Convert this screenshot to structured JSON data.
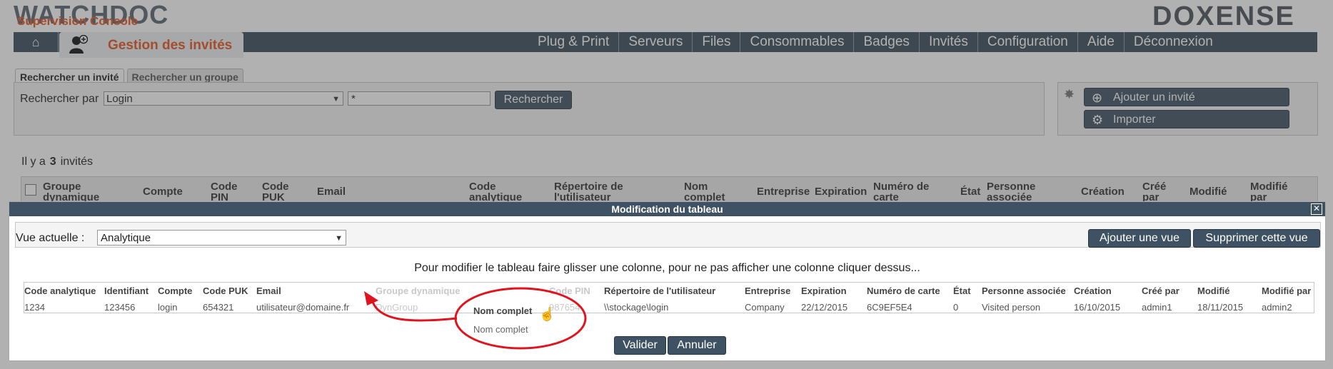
{
  "header": {
    "logo_text": "WATCHDOC",
    "logo_subtitle": "Supervision Console",
    "brand": "DOXENSE",
    "active_tab": "Gestion des invités",
    "nav_items": [
      "Plug & Print",
      "Serveurs",
      "Files",
      "Consommables",
      "Badges",
      "Invités",
      "Configuration",
      "Aide",
      "Déconnexion"
    ]
  },
  "search": {
    "tabs": [
      "Rechercher un invité",
      "Rechercher un groupe"
    ],
    "label": "Rechercher par",
    "field": "Login",
    "value": "*",
    "button": "Rechercher"
  },
  "actions": {
    "add_guest": "Ajouter un invité",
    "import": "Importer"
  },
  "count": {
    "prefix": "Il y a",
    "number": "3",
    "suffix": "invités"
  },
  "table_headers": [
    "Groupe dynamique",
    "Compte",
    "Code PIN",
    "Code PUK",
    "Email",
    "Code analytique",
    "Répertoire de l'utilisateur",
    "Nom complet",
    "Entreprise",
    "Expiration",
    "Numéro de carte",
    "État",
    "Personne associée",
    "Création",
    "Créé par",
    "Modifié",
    "Modifié par"
  ],
  "dialog": {
    "title": "Modification du tableau",
    "view_label": "Vue actuelle :",
    "view_value": "Analytique",
    "add_view": "Ajouter une vue",
    "delete_view": "Supprimer cette vue",
    "instruction": "Pour modifier le tableau faire glisser une colonne, pour ne pas afficher une colonne cliquer dessus...",
    "columns": [
      {
        "header": "Code analytique",
        "value": "1234"
      },
      {
        "header": "Identifiant",
        "value": "123456"
      },
      {
        "header": "Compte",
        "value": "login"
      },
      {
        "header": "Code PUK",
        "value": "654321"
      },
      {
        "header": "Email",
        "value": "utilisateur@domaine.fr"
      },
      {
        "header": "Groupe dynamique",
        "value": "DynGroup"
      },
      {
        "header": "Code PIN",
        "value": "987654"
      },
      {
        "header": "Répertoire de l'utilisateur",
        "value": "\\\\stockage\\login"
      },
      {
        "header": "Entreprise",
        "value": "Company"
      },
      {
        "header": "Expiration",
        "value": "22/12/2015"
      },
      {
        "header": "Numéro de carte",
        "value": "6C9EF5E4"
      },
      {
        "header": "État",
        "value": "0"
      },
      {
        "header": "Personne associée",
        "value": "Visited person"
      },
      {
        "header": "Création",
        "value": "16/10/2015"
      },
      {
        "header": "Créé par",
        "value": "admin1"
      },
      {
        "header": "Modifié",
        "value": "18/11/2015"
      },
      {
        "header": "Modifié par",
        "value": "admin2"
      }
    ],
    "dragged_header": "Nom complet",
    "dragged_value": "Nom complet",
    "validate": "Valider",
    "cancel": "Annuler"
  },
  "colors": {
    "accent": "#e8531d",
    "navbar": "#384a5a",
    "button": "#3e5263",
    "annotation": "#e0141e"
  }
}
